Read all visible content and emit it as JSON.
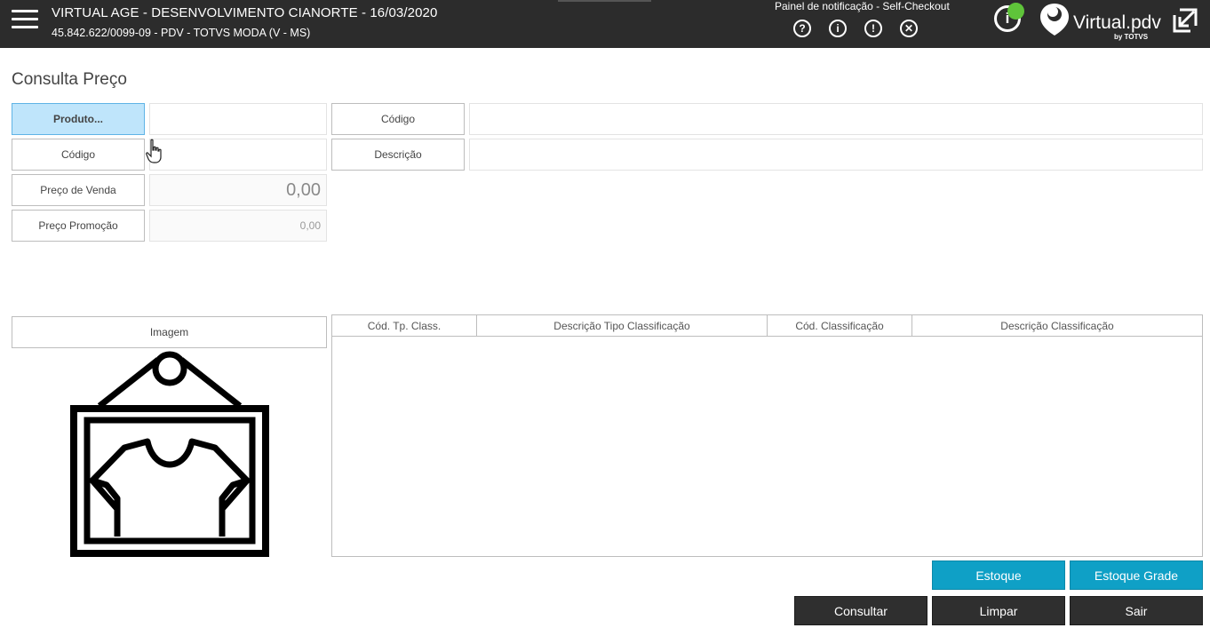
{
  "header": {
    "title": "VIRTUAL AGE - DESENVOLVIMENTO CIANORTE - 16/03/2020",
    "subtitle": "45.842.622/0099-09 - PDV - TOTVS MODA (V - MS)",
    "notification_panel_label": "Painel de notificação - Self-Checkout",
    "notification_icons": [
      {
        "name": "help-icon",
        "glyph": "?"
      },
      {
        "name": "info-icon",
        "glyph": "i"
      },
      {
        "name": "alert-icon",
        "glyph": "!"
      },
      {
        "name": "close-icon",
        "glyph": "✕"
      }
    ],
    "info_glyph": "i",
    "status_color": "#5fc43a",
    "logo_text": "Virtual.pdv",
    "logo_by": "by TOTVS"
  },
  "page": {
    "title": "Consulta Preço"
  },
  "form": {
    "produto_button": "Produto...",
    "codigo_button_right": "Código",
    "codigo_button_left": "Código",
    "descricao_button": "Descrição",
    "preco_venda_label": "Preço de Venda",
    "preco_venda_value": "0,00",
    "preco_promocao_label": "Preço Promoção",
    "preco_promocao_value": "0,00",
    "produto_value": "",
    "codigo_value": "",
    "codigo_right_value": "",
    "descricao_value": ""
  },
  "image_section": {
    "label": "Imagem"
  },
  "grid": {
    "columns": [
      "Cód. Tp. Class.",
      "Descrição Tipo Classificação",
      "Cód. Classificação",
      "Descrição Classificação"
    ],
    "rows": []
  },
  "actions": {
    "estoque": "Estoque",
    "estoque_grade": "Estoque Grade",
    "consultar": "Consultar",
    "limpar": "Limpar",
    "sair": "Sair"
  },
  "colors": {
    "header_bg": "#2c2c2c",
    "teal": "#0fa0c6",
    "dark_button": "#2f2f2f",
    "active_button": "#bfe5fb"
  }
}
